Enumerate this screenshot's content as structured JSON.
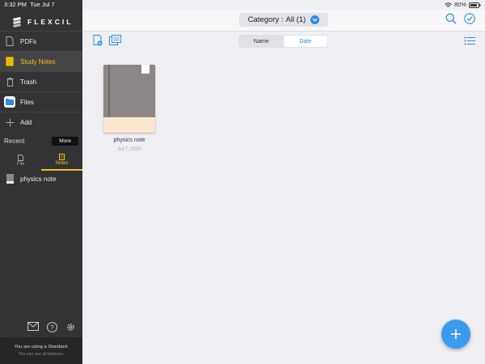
{
  "status_bar": {
    "time": "3:32 PM",
    "date": "Tue Jul 7",
    "battery": "80%"
  },
  "brand": {
    "name": "FLEXCIL"
  },
  "sidebar": {
    "items": [
      {
        "label": "PDFs",
        "icon": "pdf-file-icon"
      },
      {
        "label": "Study Notes",
        "icon": "notebook-icon",
        "active": true
      },
      {
        "label": "Trash",
        "icon": "trash-icon"
      },
      {
        "label": "Files",
        "icon": "files-app-icon"
      },
      {
        "label": "Add",
        "icon": "plus-icon"
      }
    ],
    "recent": {
      "title": "Recent",
      "more_label": "More",
      "tabs": [
        {
          "label": "File",
          "icon": "file-icon"
        },
        {
          "label": "Notes",
          "icon": "notes-icon",
          "active": true
        }
      ],
      "items": [
        {
          "label": "physics note"
        }
      ]
    },
    "plan": {
      "line1": "You are using a Standard.",
      "line2": "You can use all features."
    }
  },
  "main": {
    "category": {
      "label": "Category :",
      "value": "All (1)"
    },
    "sort": {
      "options": [
        "Name",
        "Date"
      ],
      "selected": "Date"
    },
    "notes": [
      {
        "title": "physics note",
        "date": "Jul 7, 2020"
      }
    ]
  },
  "colors": {
    "accent": "#2d8be6",
    "active": "#f5c21a",
    "sidebar_bg": "#333336",
    "cover": "#8c8686",
    "cover_band": "#fce8d0"
  }
}
